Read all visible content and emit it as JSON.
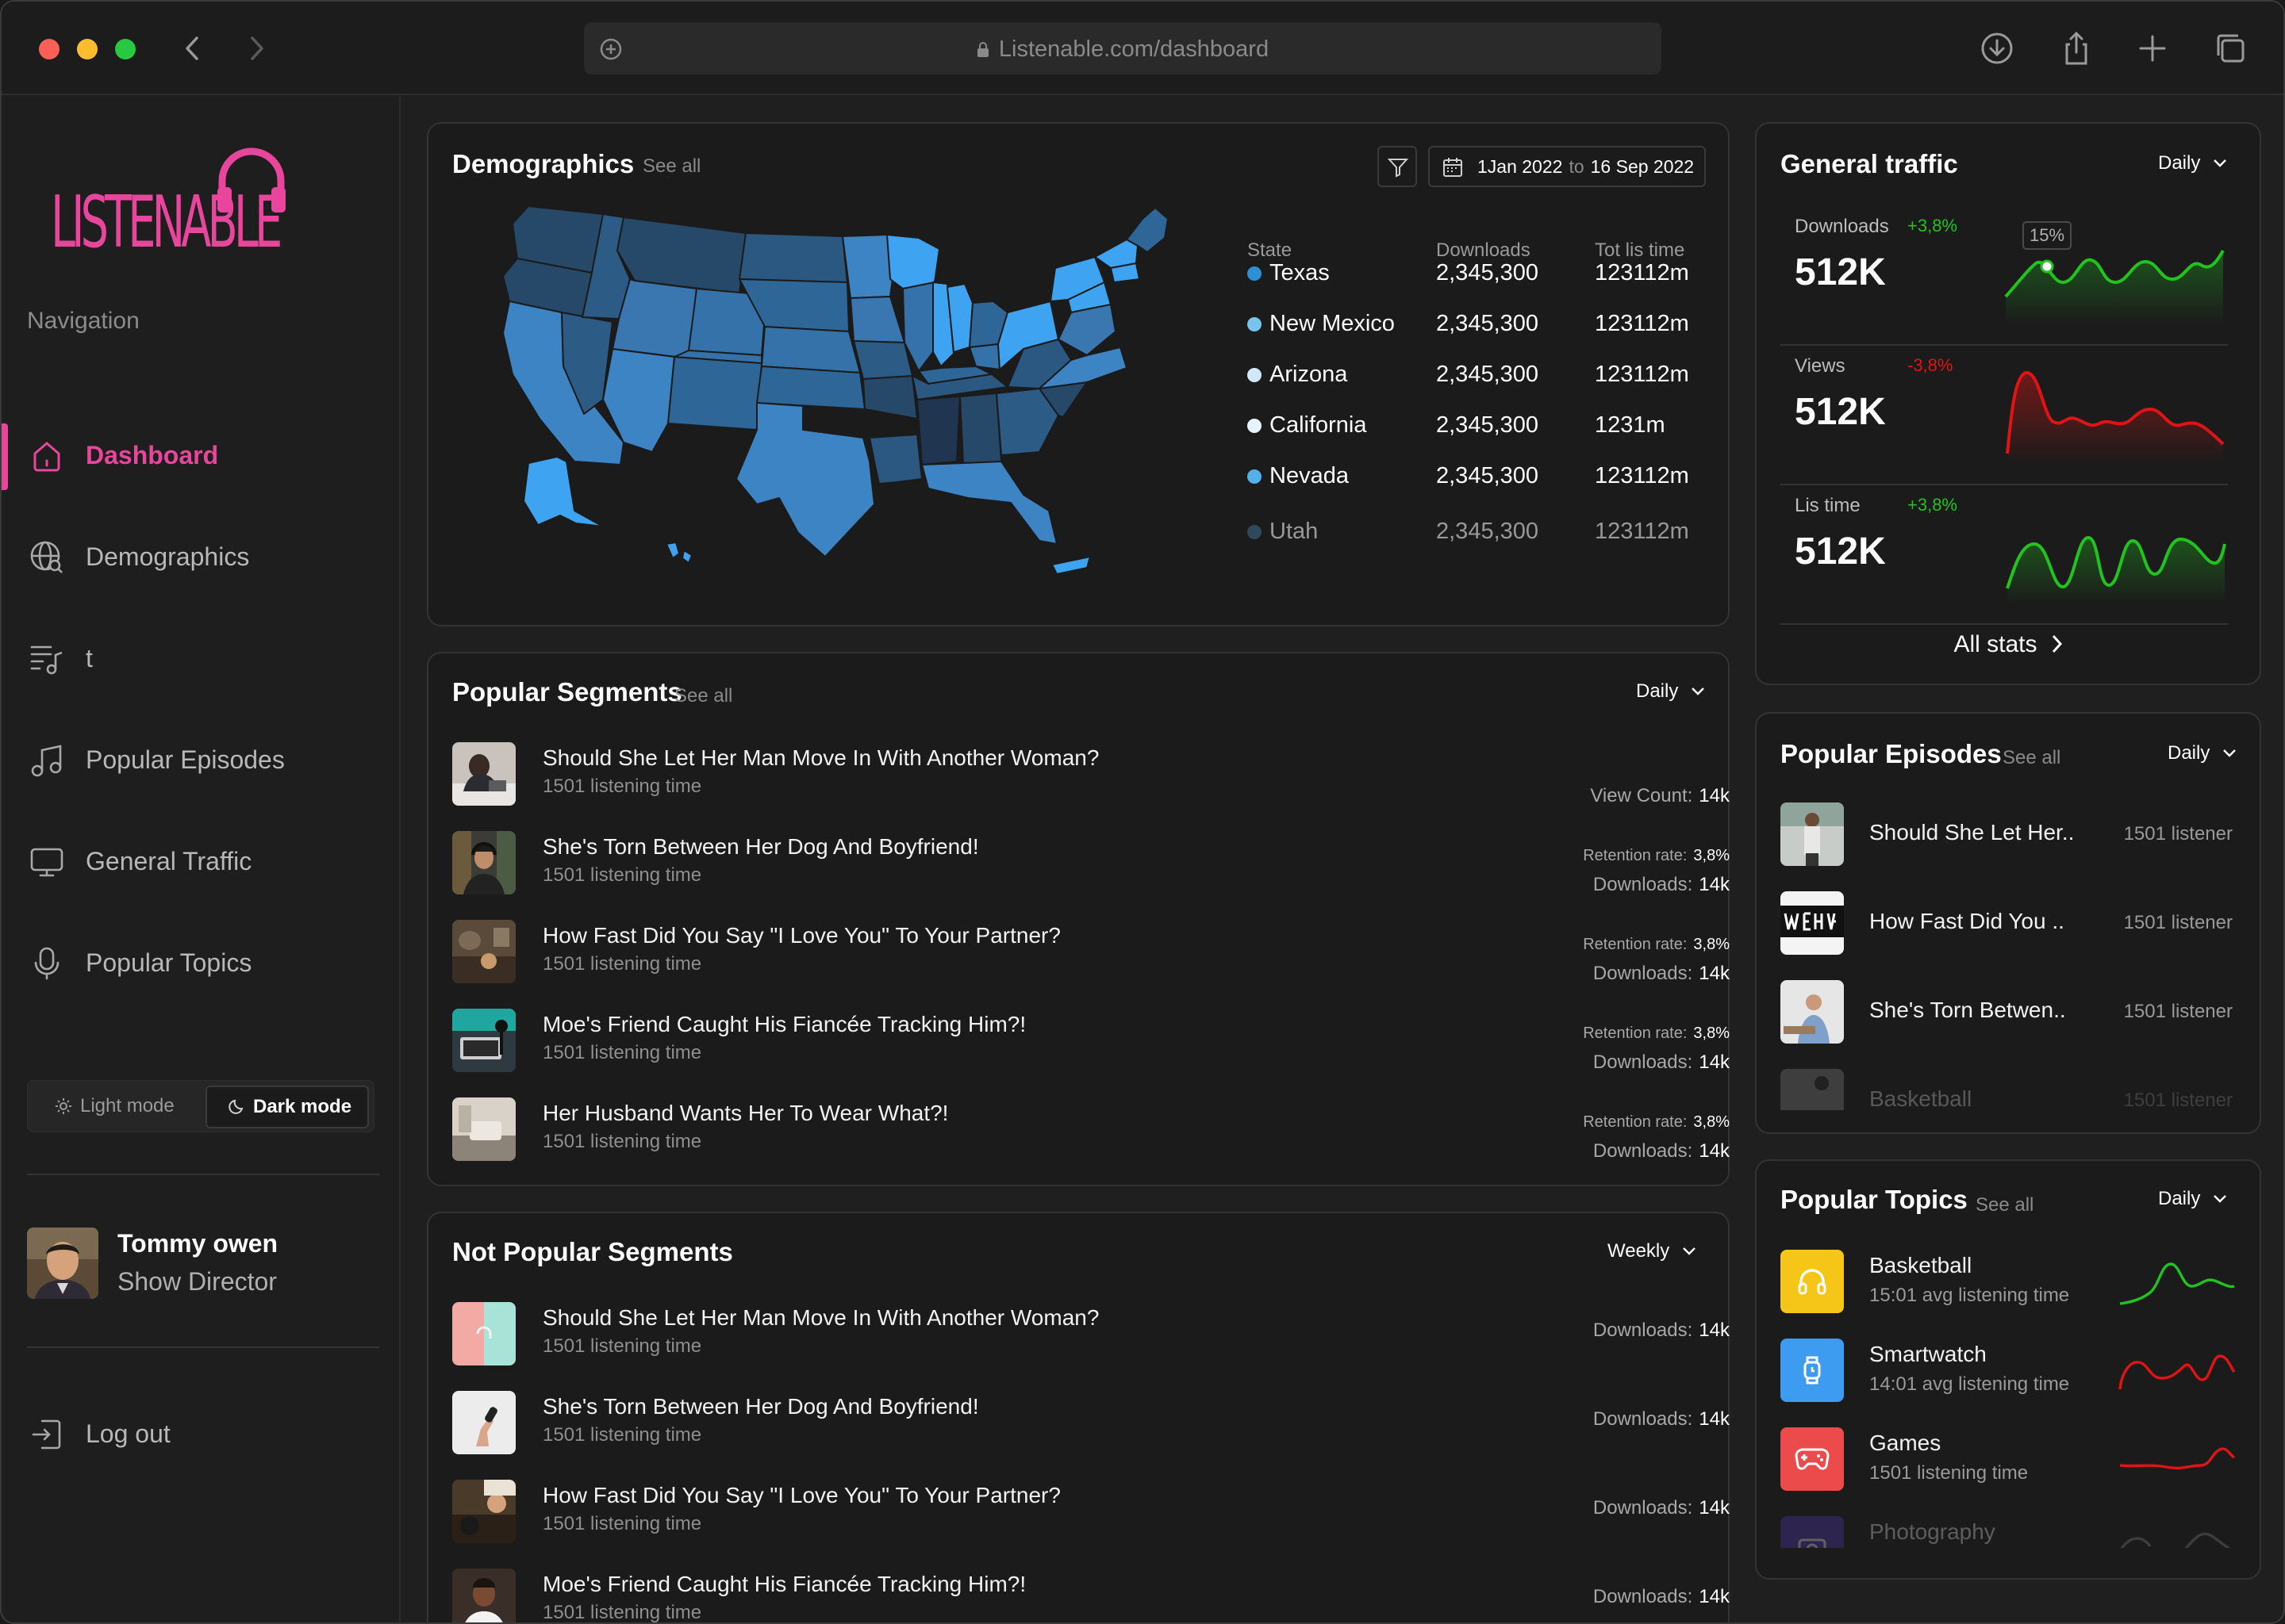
{
  "browser": {
    "url": "Listenable.com/dashboard"
  },
  "brand": {
    "name": "LISTENABLE",
    "accent": "#e8459c"
  },
  "nav": {
    "heading": "Navigation",
    "items": [
      {
        "label": "Dashboard",
        "icon": "home-icon",
        "active": true
      },
      {
        "label": "Demographics",
        "icon": "globe-search-icon"
      },
      {
        "label": "t",
        "icon": "playlist-icon"
      },
      {
        "label": "Popular Episodes",
        "icon": "music-note-icon"
      },
      {
        "label": "General Traffic",
        "icon": "monitor-icon"
      },
      {
        "label": "Popular Topics",
        "icon": "microphone-icon"
      }
    ],
    "mode": {
      "light": "Light mode",
      "dark": "Dark mode"
    },
    "user": {
      "name": "Tommy owen",
      "role": "Show Director"
    },
    "logout": "Log out"
  },
  "demographics": {
    "title": "Demographics",
    "see_all": "See all",
    "date_from": "1Jan 2022",
    "date_to_word": "to",
    "date_to": "16 Sep 2022",
    "headers": {
      "state": "State",
      "downloads": "Downloads",
      "time": "Tot lis time"
    },
    "rows": [
      {
        "state": "Texas",
        "downloads": "2,345,300",
        "time": "123112m",
        "color": "#2f8fd4"
      },
      {
        "state": "New Mexico",
        "downloads": "2,345,300",
        "time": "123112m",
        "color": "#79c3ef"
      },
      {
        "state": "Arizona",
        "downloads": "2,345,300",
        "time": "123112m",
        "color": "#cfe9fa"
      },
      {
        "state": "California",
        "downloads": "2,345,300",
        "time": "1231m",
        "color": "#e6f4fd"
      },
      {
        "state": "Nevada",
        "downloads": "2,345,300",
        "time": "123112m",
        "color": "#54b0e8"
      },
      {
        "state": "Utah",
        "downloads": "2,345,300",
        "time": "123112m",
        "color": "#3e6f94"
      }
    ]
  },
  "popular_segments": {
    "title": "Popular Segments",
    "see_all": "See all",
    "period": "Daily",
    "items": [
      {
        "title": "Should She Let Her Man Move In With Another Woman?",
        "sub": "1501 listening time",
        "r1_label": "",
        "r1_value": "",
        "r2_label": "View Count:",
        "r2_value": "14k"
      },
      {
        "title": "She's Torn Between Her Dog And Boyfriend!",
        "sub": "1501 listening time",
        "r1_label": "Retention rate:",
        "r1_value": "3,8%",
        "r2_label": "Downloads:",
        "r2_value": "14k"
      },
      {
        "title": "How Fast Did You Say \"I Love You\" To Your Partner?",
        "sub": "1501 listening time",
        "r1_label": "Retention rate:",
        "r1_value": "3,8%",
        "r2_label": "Downloads:",
        "r2_value": "14k"
      },
      {
        "title": "Moe's Friend Caught His Fiancée Tracking Him?!",
        "sub": "1501 listening time",
        "r1_label": "Retention rate:",
        "r1_value": "3,8%",
        "r2_label": "Downloads:",
        "r2_value": "14k"
      },
      {
        "title": "Her Husband Wants Her To Wear What?!",
        "sub": "1501 listening time",
        "r1_label": "Retention rate:",
        "r1_value": "3,8%",
        "r2_label": "Downloads:",
        "r2_value": "14k"
      }
    ]
  },
  "not_popular_segments": {
    "title": "Not Popular Segments",
    "period": "Weekly",
    "items": [
      {
        "title": "Should She Let Her Man Move In With Another Woman?",
        "sub": "1501 listening time",
        "label": "Downloads:",
        "value": "14k"
      },
      {
        "title": "She's Torn Between Her Dog And Boyfriend!",
        "sub": "1501 listening time",
        "label": "Downloads:",
        "value": "14k"
      },
      {
        "title": "How Fast Did You Say \"I Love You\" To Your Partner?",
        "sub": "1501 listening time",
        "label": "Downloads:",
        "value": "14k"
      },
      {
        "title": "Moe's Friend Caught His Fiancée Tracking Him?!",
        "sub": "1501 listening time",
        "label": "Downloads:",
        "value": "14k"
      }
    ]
  },
  "general_traffic": {
    "title": "General traffic",
    "period": "Daily",
    "kpis": [
      {
        "label": "Downloads",
        "change": "+3,8%",
        "value": "512K",
        "trend": "up",
        "tooltip": "15%"
      },
      {
        "label": "Views",
        "change": "-3,8%",
        "value": "512K",
        "trend": "down"
      },
      {
        "label": "Lis time",
        "change": "+3,8%",
        "value": "512K",
        "trend": "up"
      }
    ],
    "all_stats": "All stats",
    "colors": {
      "up": "#22c21f",
      "down": "#e01414"
    }
  },
  "popular_episodes": {
    "title": "Popular Episodes",
    "see_all": "See all",
    "period": "Daily",
    "items": [
      {
        "title": "Should She Let Her..",
        "count": "1501 listener"
      },
      {
        "title": "How Fast Did You ..",
        "count": "1501 listener"
      },
      {
        "title": "She's Torn Betwen..",
        "count": "1501 listener"
      },
      {
        "title": "Basketball",
        "count": "1501 listener"
      }
    ]
  },
  "popular_topics": {
    "title": "Popular Topics",
    "see_all": "See all",
    "period": "Daily",
    "items": [
      {
        "title": "Basketball",
        "sub": "15:01 avg listening time",
        "color": "#f5c518",
        "icon": "headphones-icon",
        "trend": "up"
      },
      {
        "title": "Smartwatch",
        "sub": "14:01 avg listening time",
        "color": "#3d9cf0",
        "icon": "watch-icon",
        "trend": "down"
      },
      {
        "title": "Games",
        "sub": "1501 listening time",
        "color": "#ec4b4b",
        "icon": "gamepad-icon",
        "trend": "down"
      },
      {
        "title": "Photography",
        "sub": "",
        "color": "#5b3ec4",
        "icon": "camera-icon",
        "trend": "up"
      }
    ]
  }
}
